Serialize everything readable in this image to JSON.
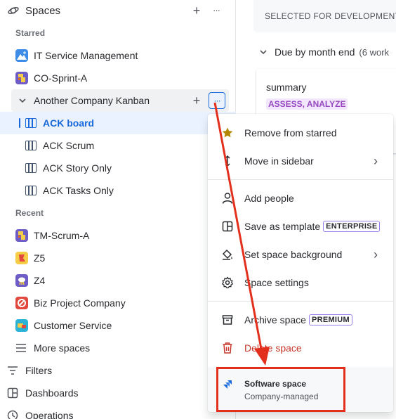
{
  "sidebar": {
    "title": "Spaces",
    "starred_label": "Starred",
    "starred": [
      {
        "label": "IT Service Management",
        "icon": "it-service-icon"
      },
      {
        "label": "CO-Sprint-A",
        "icon": "co-sprint-icon"
      },
      {
        "label": "Another Company Kanban",
        "icon": "chevron-down-icon"
      }
    ],
    "boards": [
      {
        "label": "ACK board",
        "selected": true
      },
      {
        "label": "ACK Scrum"
      },
      {
        "label": "ACK Story Only"
      },
      {
        "label": "ACK Tasks Only"
      }
    ],
    "recent_label": "Recent",
    "recent": [
      {
        "label": "TM-Scrum-A"
      },
      {
        "label": "Z5"
      },
      {
        "label": "Z4"
      },
      {
        "label": "Biz Project Company"
      },
      {
        "label": "Customer Service"
      }
    ],
    "more_spaces": "More spaces",
    "filters": "Filters",
    "dashboards": "Dashboards",
    "operations": "Operations",
    "plus_glyph": "+",
    "more_glyph": "···",
    "expand_glyph": "⌄"
  },
  "main": {
    "column_header": "SELECTED FOR DEVELOPMENT",
    "group_title": "Due by month end",
    "group_count": "(6 work",
    "card": {
      "summary": "summary",
      "status": "ASSESS, ANALYZE"
    }
  },
  "menu": {
    "items": [
      {
        "label": "Remove from starred",
        "icon": "star-icon"
      },
      {
        "label": "Move in sidebar",
        "icon": "move-icon",
        "submenu": true
      },
      {
        "label": "Add people",
        "icon": "person-icon"
      },
      {
        "label": "Save as template",
        "icon": "template-icon",
        "badge": "ENTERPRISE"
      },
      {
        "label": "Set space background",
        "icon": "paint-bucket-icon",
        "submenu": true
      },
      {
        "label": "Space settings",
        "icon": "gear-icon"
      },
      {
        "label": "Archive space",
        "icon": "archive-icon",
        "badge": "PREMIUM"
      },
      {
        "label": "Delete space",
        "icon": "trash-icon"
      }
    ],
    "chevron_glyph": "›",
    "footer": {
      "title": "Software space",
      "subtitle": "Company-managed"
    }
  },
  "colors": {
    "accent": "#1868db",
    "selected_bg": "#e9f2fe",
    "danger": "#c9372c",
    "annotation": "#e3301d",
    "lozenge_bg": "#f3e6ff",
    "lozenge_text": "#964ac0"
  }
}
